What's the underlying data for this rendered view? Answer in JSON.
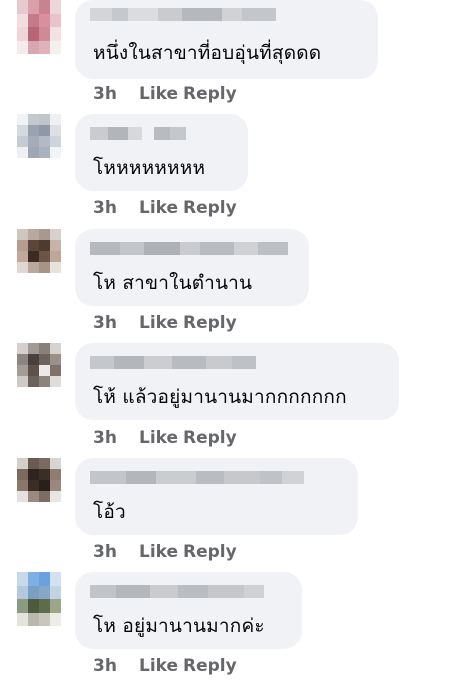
{
  "comments": [
    {
      "text": "หนึ่งในสาขาที่อบอุ่นที่สุดดด",
      "time": "3h",
      "like": "Like",
      "reply": "Reply"
    },
    {
      "text": "โหหหหหหหห",
      "time": "3h",
      "like": "Like",
      "reply": "Reply"
    },
    {
      "text": "โห สาขาในตำนาน",
      "time": "3h",
      "like": "Like",
      "reply": "Reply"
    },
    {
      "text": "โห้ แล้วอยู่มานานมากกกกกกก",
      "time": "3h",
      "like": "Like",
      "reply": "Reply"
    },
    {
      "text": "โอ้ว",
      "time": "3h",
      "like": "Like",
      "reply": "Reply"
    },
    {
      "text": "โห อยู่มานานมากค่ะ",
      "time": "3h",
      "like": "Like",
      "reply": "Reply"
    }
  ],
  "colors": {
    "bubble": "#f0f2f5",
    "text": "#050505",
    "meta": "#65676b"
  }
}
